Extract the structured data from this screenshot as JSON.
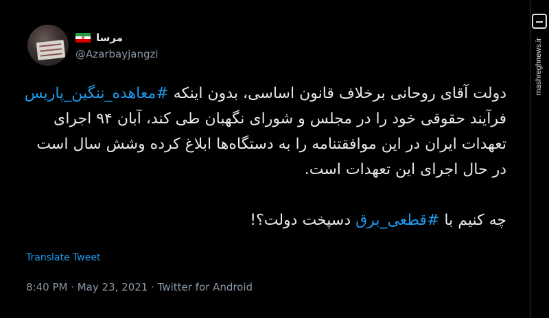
{
  "tweet": {
    "display_name": "مرسا",
    "handle": "@Azarbayjangzi",
    "body": {
      "part1": "دولت آقای روحانی برخلاف قانون اساسی، بدون اینکه ",
      "hashtag1": "#معاهده_ننگین_پاریس",
      "part2": " فرآیند حقوقی خود را در مجلس و شورای نگهبان طی کند، آبان ۹۴ اجرای تعهدات ایران در این موافقتنامه را به دستگاه‌ها ابلاغ کرده وشش سال است در حال اجرای این تعهدات است.",
      "part3": "چه کنیم با ",
      "hashtag2": "#قطعی_برق",
      "part4": " دسپخت دولت؟!"
    },
    "translate_label": "Translate Tweet",
    "timestamp": "8:40 PM · May 23, 2021 · Twitter for Android"
  },
  "watermark": {
    "site": "mashreghnews.ir",
    "logo": "مشرق"
  },
  "colors": {
    "background": "#000000",
    "text": "#e7e9ea",
    "link": "#1d9bf0",
    "muted": "#8b98a5"
  }
}
